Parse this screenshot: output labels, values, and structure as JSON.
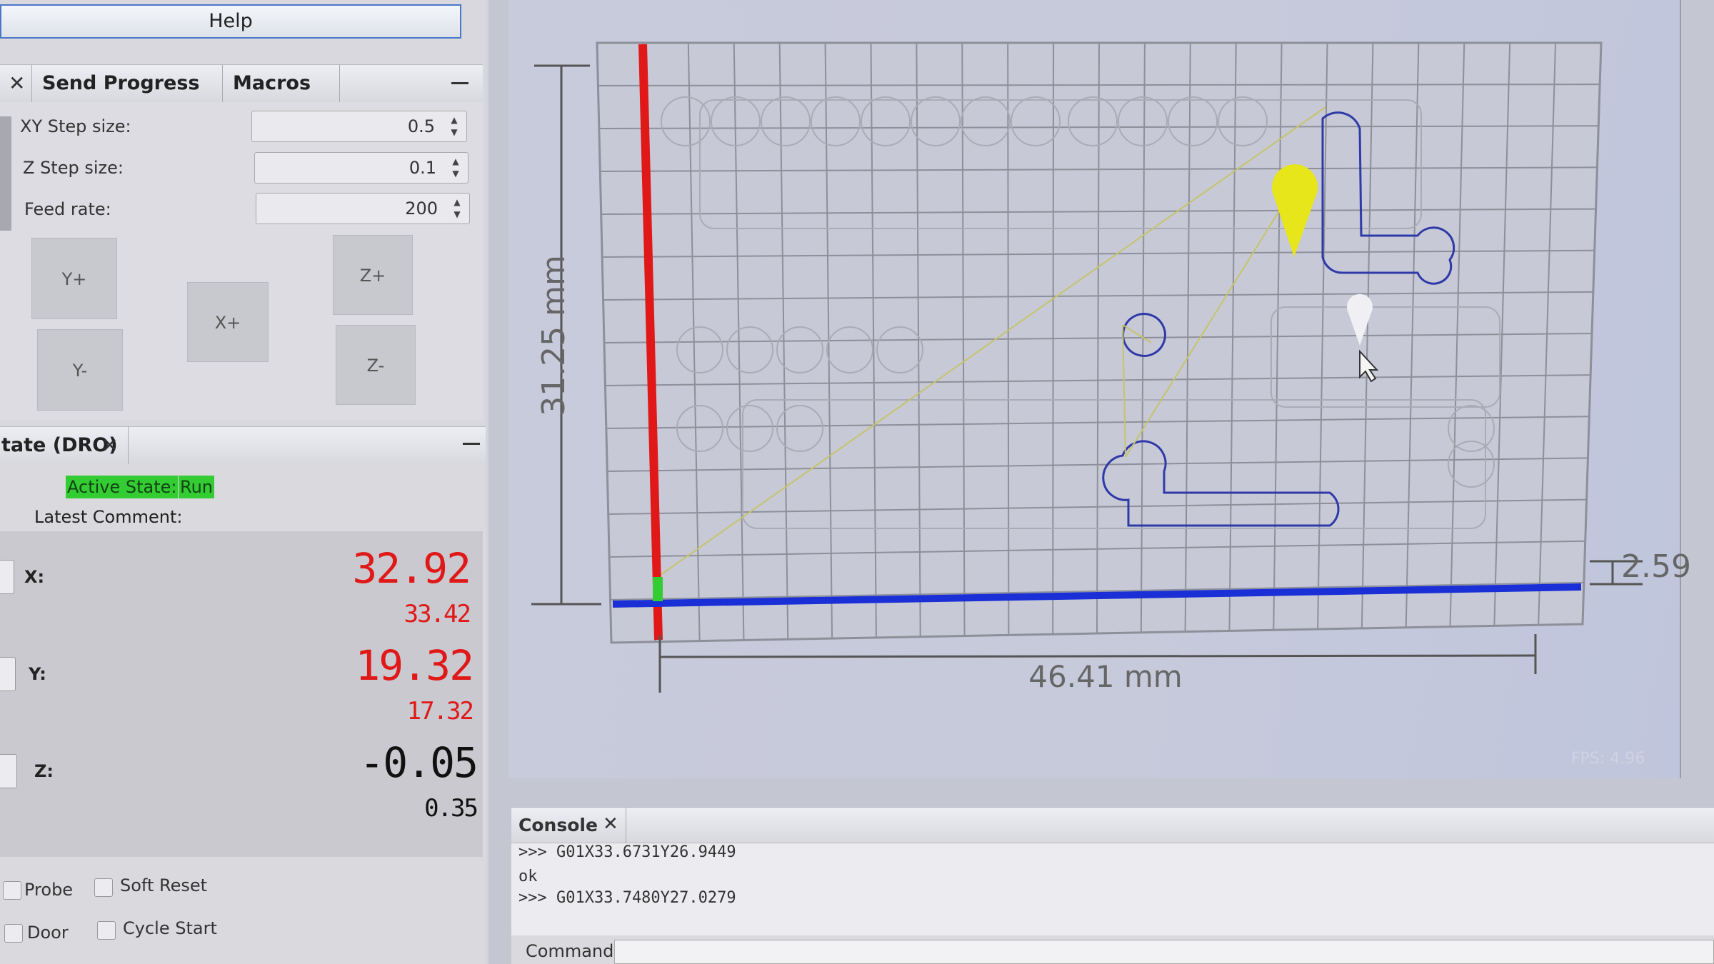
{
  "menu": {
    "help": "Help"
  },
  "panel1": {
    "tabs": [
      {
        "label": "Send Progress"
      },
      {
        "label": "Macros"
      }
    ]
  },
  "jog": {
    "xy_step_label": "XY Step size:",
    "xy_step_value": "0.5",
    "z_step_label": "Z Step size:",
    "z_step_value": "0.1",
    "feed_label": "Feed rate:",
    "feed_value": "200",
    "buttons": {
      "y_plus": "Y+",
      "y_minus": "Y-",
      "x_plus": "X+",
      "z_plus": "Z+",
      "z_minus": "Z-"
    }
  },
  "dro": {
    "tab_label": "tate (DRO)",
    "active_state_label": "Active State:",
    "active_state_value": "Run",
    "latest_comment_label": "Latest Comment:",
    "axes": [
      {
        "label": "X:",
        "work": "32.92",
        "machine": "33.42"
      },
      {
        "label": "Y:",
        "work": "19.32",
        "machine": "17.32"
      },
      {
        "label": "Z:",
        "work": "-0.05",
        "machine": "0.35"
      }
    ],
    "checkboxes": {
      "probe": "Probe",
      "soft_reset": "Soft Reset",
      "door": "Door",
      "cycle_start": "Cycle Start"
    }
  },
  "visualizer": {
    "y_dimension": "31.25 mm",
    "x_dimension": "46.41 mm",
    "z_dimension": "2.59",
    "fps": "FPS: 4.96",
    "colors": {
      "x_axis": "#e01818",
      "y_axis": "#1a2fd6",
      "tool": "#e6e61a",
      "toolpath": "#2f3aa8"
    }
  },
  "console": {
    "tab_label": "Console",
    "lines": [
      ">>> G01X33.6731Y26.9449",
      "ok",
      ">>> G01X33.7480Y27.0279"
    ],
    "command_label": "Command:"
  }
}
